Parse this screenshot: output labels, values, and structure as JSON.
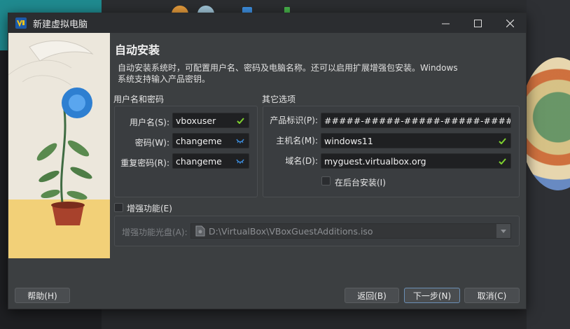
{
  "window": {
    "title": "新建虚拟电脑"
  },
  "header": {
    "heading": "自动安装",
    "description_line1": "自动安装系统时，可配置用户名、密码及电脑名称。还可以启用扩展增强包安装。Windows",
    "description_line2": "系统支持输入产品密钥。"
  },
  "user_group": {
    "title": "用户名和密码",
    "username_label": "用户名(S):",
    "username_value": "vboxuser",
    "password_label": "密码(W):",
    "password_value": "changeme",
    "repeat_label": "重复密码(R):",
    "repeat_value": "changeme"
  },
  "other_group": {
    "title": "其它选项",
    "product_key_label": "产品标识(P):",
    "product_key_value": "#####-#####-#####-#####-#####",
    "hostname_label": "主机名(M):",
    "hostname_value": "windows11",
    "domain_label": "域名(D):",
    "domain_value": "myguest.virtualbox.org",
    "background_install_label": "在后台安装(I)"
  },
  "additions": {
    "checkbox_label": "增强功能(E)",
    "iso_label": "增强功能光盘(A):",
    "iso_value": "D:\\VirtualBox\\VBoxGuestAdditions.iso"
  },
  "buttons": {
    "help": "帮助(H)",
    "back": "返回(B)",
    "next": "下一步(N)",
    "cancel": "取消(C)"
  },
  "colors": {
    "valid_check": "#7fd12f",
    "password_icon": "#3d8fe0"
  }
}
